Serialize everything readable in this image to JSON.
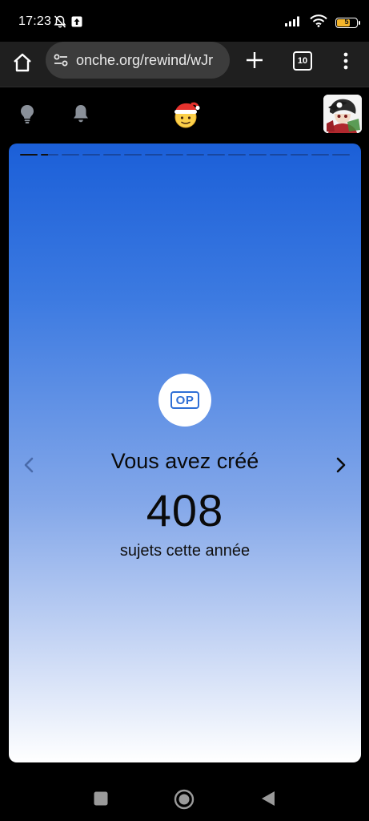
{
  "status_bar": {
    "time": "17:23",
    "battery_level": "5",
    "battery_color": "#f5b52a"
  },
  "browser": {
    "url": "onche.org/rewind/wJr",
    "tab_count": "10"
  },
  "app_header": {
    "logo": "🎅",
    "icons": [
      "lightbulb-icon",
      "bell-icon"
    ]
  },
  "story": {
    "progress_total": 16,
    "progress_current": 2,
    "badge_text": "OP",
    "heading": "Vous avez créé",
    "count": "408",
    "caption": "sujets cette année",
    "gradient_top": "#1b5fd8",
    "gradient_bottom": "#ffffff",
    "accent": "#2f6fd6"
  }
}
